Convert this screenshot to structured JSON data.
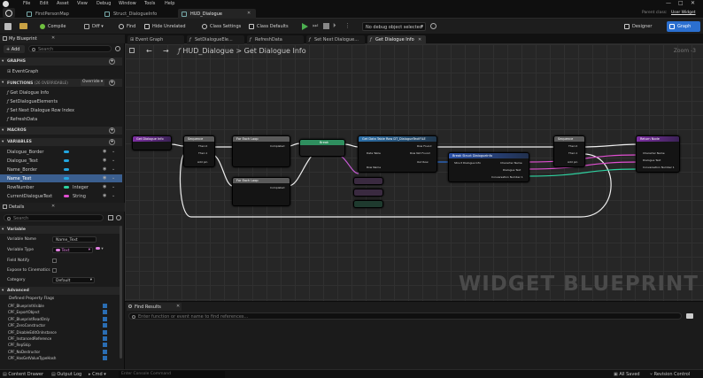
{
  "menu": [
    "File",
    "Edit",
    "Asset",
    "View",
    "Debug",
    "Window",
    "Tools",
    "Help"
  ],
  "doc_tabs": [
    {
      "label": "FirstPersonMap",
      "active": false
    },
    {
      "label": "Struct_DialogueInfo",
      "active": false
    },
    {
      "label": "HUD_Dialogue",
      "active": true
    }
  ],
  "parent_class": {
    "label": "Parent class:",
    "value": "User Widget"
  },
  "toolbar": {
    "compile": "Compile",
    "diff": "Diff",
    "find": "Find",
    "hide_unrelated": "Hide Unrelated",
    "class_settings": "Class Settings",
    "class_defaults": "Class Defaults",
    "debug_filter": "No debug object selected",
    "designer": "Designer",
    "graph": "Graph"
  },
  "my_blueprint": {
    "title": "My Blueprint",
    "add": "+ Add",
    "search_placeholder": "Search",
    "sections": {
      "graphs": "GRAPHS",
      "functions": "FUNCTIONS",
      "functions_count": "(26 OVERRIDABLE)",
      "override": "Override",
      "macros": "MACROS",
      "variables": "VARIABLES"
    },
    "graphs": [
      "EventGraph"
    ],
    "functions": [
      "Get Dialogue Info",
      "SetDialogueElements",
      "Set Next Dialogue Row Index",
      "RefreshData"
    ],
    "variables": [
      {
        "name": "Dialogue_Border",
        "type": "",
        "color": "#22a6e0",
        "selected": false
      },
      {
        "name": "Dialogue_Text",
        "type": "",
        "color": "#22a6e0",
        "selected": false
      },
      {
        "name": "Name_Border",
        "type": "",
        "color": "#22a6e0",
        "selected": false
      },
      {
        "name": "Name_Text",
        "type": "",
        "color": "#22a6e0",
        "selected": true
      },
      {
        "name": "RowNumber",
        "type": "Integer",
        "color": "#2fd1a0",
        "selected": false
      },
      {
        "name": "CurrentDialogueText",
        "type": "String",
        "color": "#e04fd1",
        "selected": false
      }
    ]
  },
  "details": {
    "title": "Details",
    "search_placeholder": "Search",
    "variable_section": "Variable",
    "variable_name_label": "Variable Name",
    "variable_name_value": "Name_Text",
    "variable_type_label": "Variable Type",
    "variable_type_value": "Text",
    "field_notify_label": "Field Notify",
    "expose_label": "Expose to Cinematics",
    "category_label": "Category",
    "category_value": "Default",
    "advanced_section": "Advanced",
    "flags_label": "Defined Property Flags",
    "flags": [
      "CPF_BlueprintVisible",
      "CPF_ExportObject",
      "CPF_BlueprintReadOnly",
      "CPF_ZeroConstructor",
      "CPF_DisableEditOnInstance",
      "CPF_InstancedReference",
      "CPF_RepSkip",
      "CPF_NoDestructor",
      "CPF_HasGetValueTypeHash"
    ]
  },
  "graph_tabs": [
    "Event Graph",
    "SetDialogueEle...",
    "RefreshData",
    "Set Next Dialogue...",
    "Get Dialogue Info"
  ],
  "breadcrumb": {
    "root": "HUD_Dialogue",
    "sep": ">",
    "current": "Get Dialogue Info"
  },
  "zoom": "Zoom -3",
  "watermark": "WIDGET BLUEPRINT",
  "nodes": {
    "entry": "Get Dialogue Info",
    "sequence1": "Sequence",
    "for_each1": "For Each Loop",
    "break1": "Break",
    "for_each2": "For Each Loop",
    "get_row": "Get Data Table Row DT_DialogueTextFILE",
    "break_struct": "Break Struct DialogueInfo",
    "sequence2": "Sequence",
    "return": "Return Node",
    "pins": {
      "then0": "Then 0",
      "then1": "Then 1",
      "add_pin": "Add pin",
      "completed": "Completed",
      "data_table": "Data Table",
      "row_name": "Row Name",
      "row_found": "Row Found",
      "row_not_found": "Row Not Found",
      "out_row": "Out Row",
      "character_name": "Character Name",
      "dialogue_text": "Dialogue Text",
      "conversation_number": "Conversation Number 1",
      "struct_in": "Struct Dialogue Info"
    }
  },
  "find_results": {
    "title": "Find Results",
    "placeholder": "Enter function or event name to find references..."
  },
  "statusbar": {
    "content_drawer": "Content Drawer",
    "output_log": "Output Log",
    "cmd": "Cmd",
    "console_placeholder": "Enter Console Command",
    "saved": "All Saved",
    "revision": "Revision Control"
  }
}
